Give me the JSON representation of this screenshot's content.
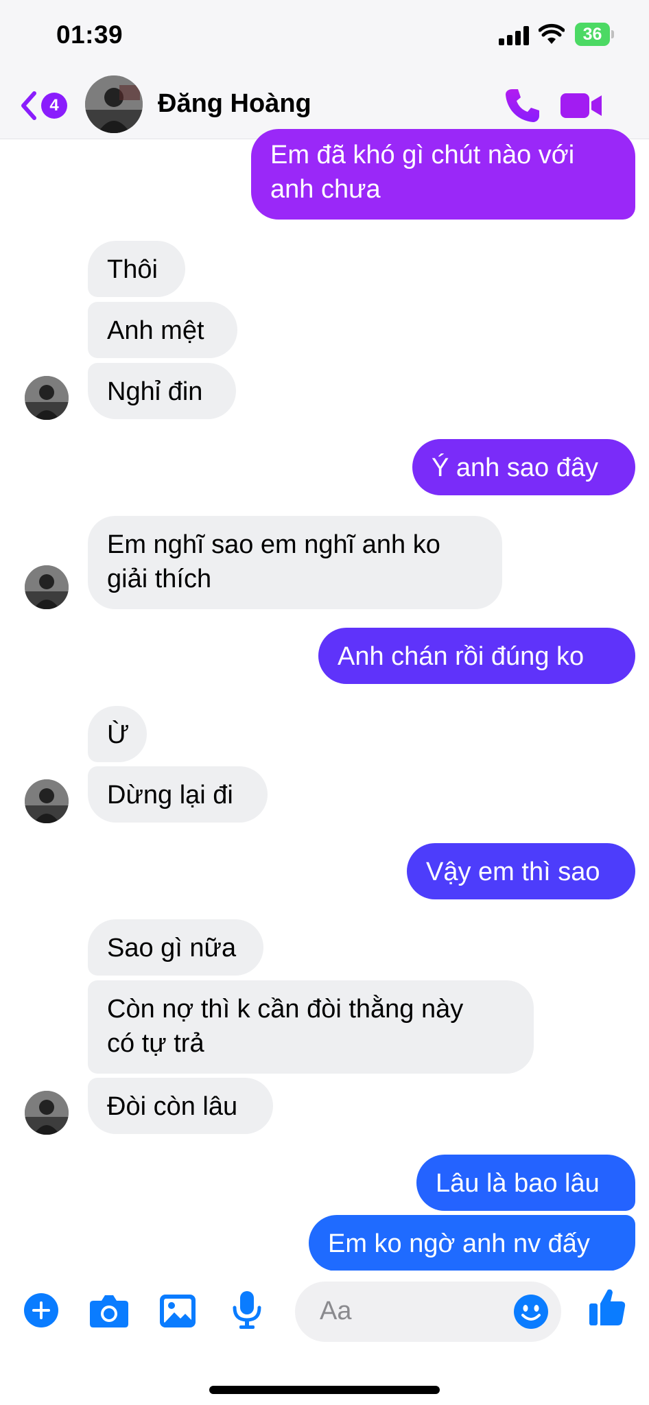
{
  "status_bar": {
    "time": "01:39",
    "battery": "36"
  },
  "header": {
    "back_badge": "4",
    "contact_name": "Đăng Hoàng"
  },
  "messages": [
    {
      "text": "Em đã khó gì chút nào với\nanh chưa",
      "direction": "sent"
    },
    {
      "text": "Thôi",
      "direction": "received"
    },
    {
      "text": "Anh mệt",
      "direction": "received"
    },
    {
      "text": "Nghỉ đin",
      "direction": "received"
    },
    {
      "text": "Ý anh sao đây",
      "direction": "sent"
    },
    {
      "text": "Em nghĩ sao em nghĩ anh ko\ngiải thích",
      "direction": "received"
    },
    {
      "text": "Anh chán rồi đúng ko",
      "direction": "sent"
    },
    {
      "text": "Ừ",
      "direction": "received"
    },
    {
      "text": "Dừng lại đi",
      "direction": "received"
    },
    {
      "text": "Vậy em thì sao",
      "direction": "sent"
    },
    {
      "text": "Sao gì nữa",
      "direction": "received"
    },
    {
      "text": "Còn nợ thì k cần đòi thằng này\ncó tự trả",
      "direction": "received"
    },
    {
      "text": "Đòi còn lâu",
      "direction": "received"
    },
    {
      "text": "Lâu là bao lâu",
      "direction": "sent"
    },
    {
      "text": "Em ko ngờ anh nv đấy",
      "direction": "sent"
    }
  ],
  "composer": {
    "placeholder": "Aa",
    "icons": [
      "plus-icon",
      "camera-icon",
      "photo-icon",
      "microphone-icon",
      "emoji-icon",
      "thumbs-up-icon"
    ]
  },
  "colors": {
    "accent": "#0a7cff",
    "gradient_top": "#a71ff5",
    "gradient_bottom": "#1f6bff",
    "received_bubble": "#eeeff1"
  }
}
